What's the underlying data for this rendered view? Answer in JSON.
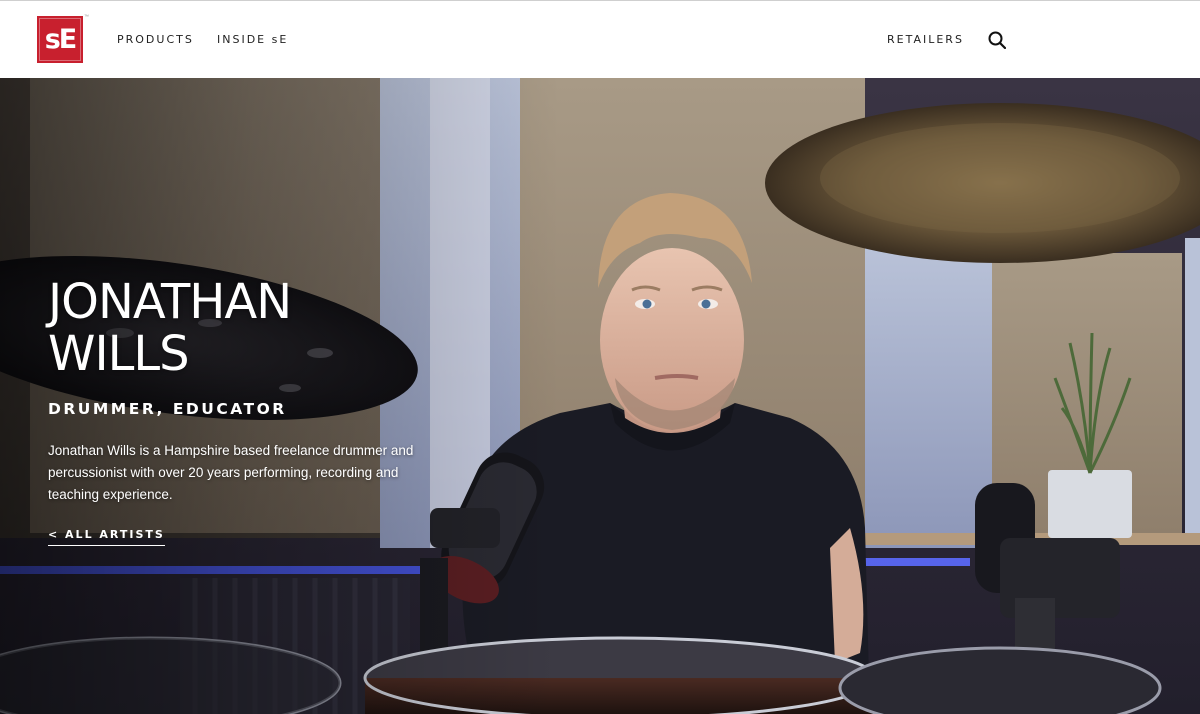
{
  "header": {
    "logo_text": "sE",
    "nav": {
      "products": "PRODUCTS",
      "inside": "INSIDE sE",
      "retailers": "RETAILERS"
    },
    "search_icon": "search-icon"
  },
  "hero": {
    "name_line1": "JONATHAN",
    "name_line2": "WILLS",
    "role": "DRUMMER, EDUCATOR",
    "bio": "Jonathan Wills is a Hampshire based freelance drummer and percussionist with over 20 years performing, recording and teaching experience.",
    "back_link": "< ALL ARTISTS"
  },
  "colors": {
    "brand": "#c8202e",
    "text_dark": "#222222",
    "hero_text": "#ffffff"
  }
}
